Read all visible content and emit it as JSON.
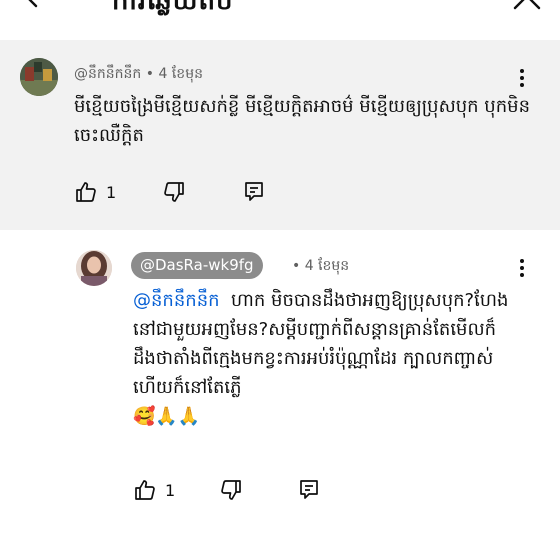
{
  "header": {
    "title": "ការឆ្លើយតប"
  },
  "parent_comment": {
    "author": "@នឹកនឹកនឹក",
    "separator": "•",
    "age": "4 ខែមុន",
    "text": "មីខ្មើយចង្រៃមីខ្មើយសក់ខ្លី មីខ្មើយក្ដិតអាចម៌ មីខ្មើយឲ្យប្រុសបុក បុកមិនចេះឈឺក្ដិត",
    "like_count": "1"
  },
  "reply": {
    "author": "@DasRa-wk9fg",
    "separator": "•",
    "age": "4 ខែមុន",
    "mention": "@នឹកនឹកនឹក",
    "text": "ហាក មិចបានដឹងថាអញឱ្យប្រុសបុក?ហែងនៅជាមួយអញមែន?សម្ដីបញ្ជាក់ពីសន្ដានគ្រាន់តែមើលក៏ដឹងថាតាំងពីក្មេងមកខ្វះការអប់រំប៉ុណ្ណាដែរ ក្បាលកញ្ចាស់ហើយក៏នៅតែភ្លើ",
    "emoji": "🥰🙏🙏",
    "like_count": "1"
  },
  "colors": {
    "parent_background": "#f2f2f2",
    "mention_blue": "#065fd4",
    "handle_chip": "#8c8c8c",
    "meta_gray": "#606060"
  },
  "icons": [
    "back-arrow-icon",
    "close-icon",
    "more-vert-icon",
    "thumb-up-icon",
    "thumb-down-icon",
    "reply-icon"
  ]
}
